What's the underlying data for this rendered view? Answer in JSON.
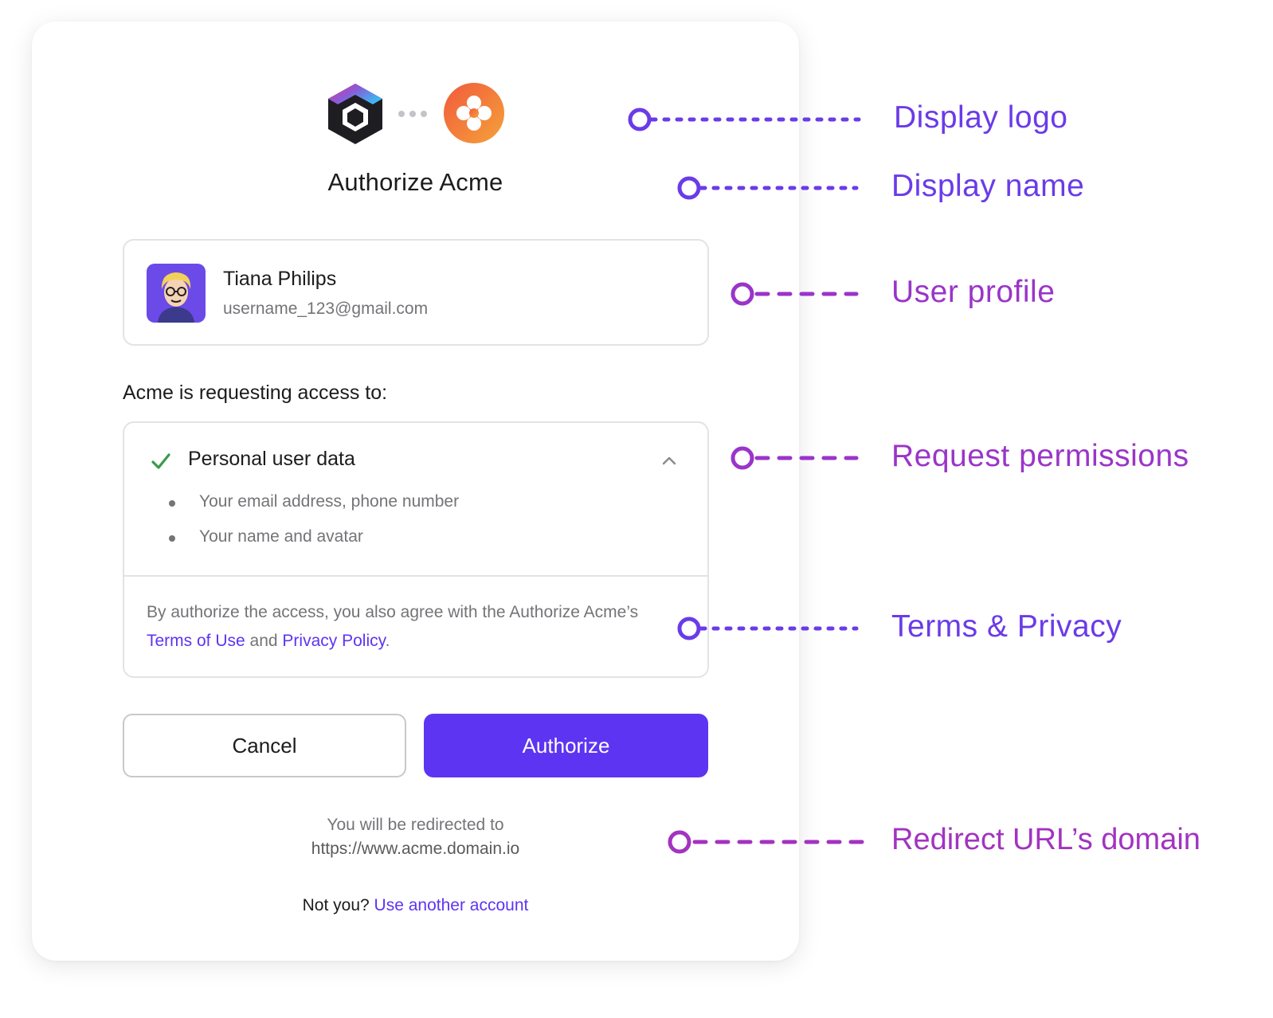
{
  "dialog": {
    "title": "Authorize Acme",
    "profile": {
      "name": "Tiana Philips",
      "email": "username_123@gmail.com"
    },
    "request_label": "Acme is requesting access to:",
    "permission": {
      "title": "Personal user data",
      "items": [
        "Your email address, phone number",
        "Your name and avatar"
      ]
    },
    "terms": {
      "prefix": "By authorize the access, you also agree with the Authorize Acme’s ",
      "terms_link": "Terms of Use",
      "middle": " and ",
      "privacy_link": "Privacy Policy",
      "suffix": "."
    },
    "buttons": {
      "cancel": "Cancel",
      "authorize": "Authorize"
    },
    "redirect": {
      "text": "You will be redirected to",
      "url": "https://www.acme.domain.io"
    },
    "footer": {
      "not_you": "Not you?",
      "switch_link": "Use another account"
    },
    "colors": {
      "accent": "#5d34f2",
      "check": "#3a9a4a"
    },
    "icons": {
      "app_logo": "hexagon-logo-icon",
      "acme_logo": "clover-logo-icon",
      "check": "check-icon",
      "chevron": "chevron-up-icon"
    }
  },
  "annotations": [
    {
      "label": "Display logo",
      "color": "#6a3be8"
    },
    {
      "label": "Display name",
      "color": "#6a3be8"
    },
    {
      "label": "User profile",
      "color": "#9a35c8"
    },
    {
      "label": "Request permissions",
      "color": "#9a35c8"
    },
    {
      "label": "Terms & Privacy",
      "color": "#6a3be8"
    },
    {
      "label": "Redirect URL’s domain",
      "color": "#a333c0"
    }
  ]
}
